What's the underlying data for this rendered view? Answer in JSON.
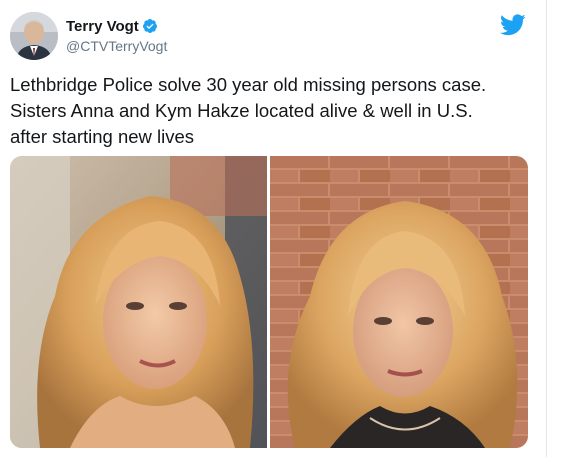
{
  "tweet": {
    "display_name": "Terry Vogt",
    "handle": "@CTVTerryVogt",
    "text": "Lethbridge Police solve 30 year old missing persons case.\nSisters Anna and Kym Hakze located alive & well in U.S.\nafter starting new lives",
    "media": [
      {
        "label": "photo-of-anna-hakze"
      },
      {
        "label": "photo-of-kym-hakze"
      }
    ]
  },
  "icons": {
    "brand": "twitter-bird-icon",
    "verified": "verified-badge-icon"
  },
  "colors": {
    "twitter_blue": "#1da1f2",
    "text": "#14171a",
    "secondary_text": "#657786"
  }
}
